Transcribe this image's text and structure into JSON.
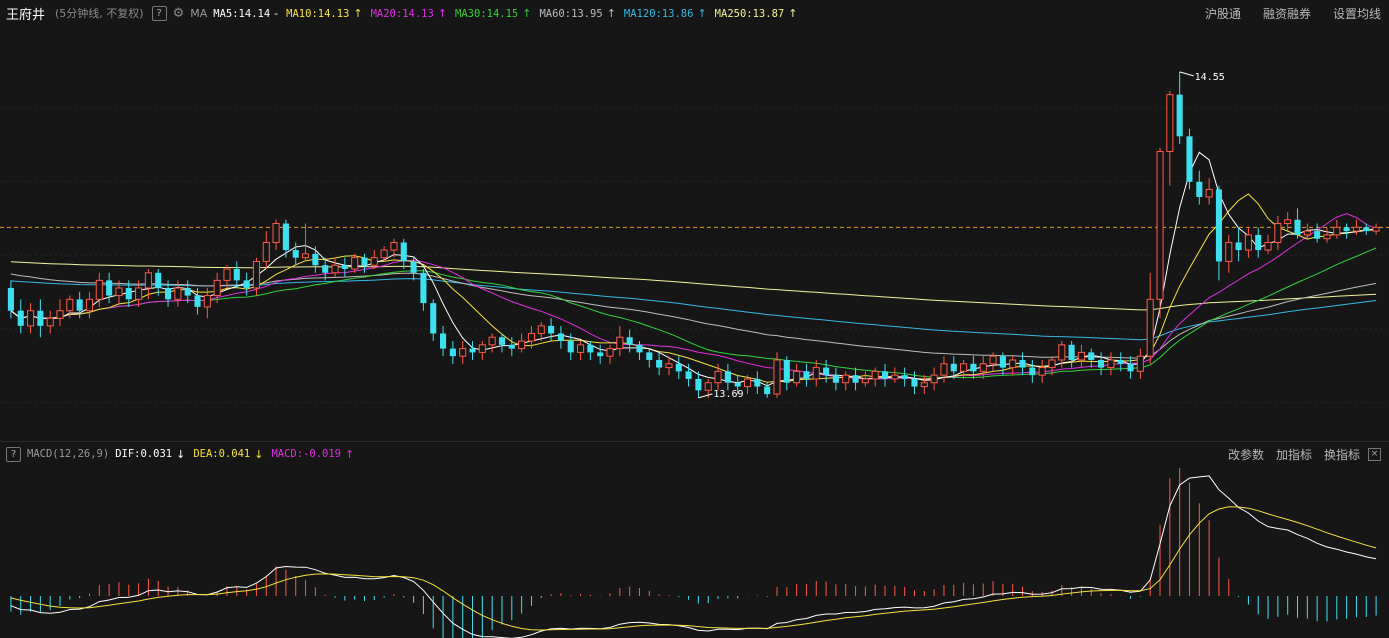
{
  "header": {
    "stock_name": "王府井",
    "period": "(5分钟线, 不复权)",
    "help": "?",
    "indicator": "MA",
    "ma": [
      {
        "label": "MA5:14.14",
        "arrow": "-",
        "color": "#ffffff"
      },
      {
        "label": "MA10:14.13",
        "arrow": "↑",
        "color": "#f7e23e"
      },
      {
        "label": "MA20:14.13",
        "arrow": "↑",
        "color": "#e030e0"
      },
      {
        "label": "MA30:14.15",
        "arrow": "↑",
        "color": "#34d23a"
      },
      {
        "label": "MA60:13.95",
        "arrow": "↑",
        "color": "#bdbdbd"
      },
      {
        "label": "MA120:13.86",
        "arrow": "↑",
        "color": "#35b8e8"
      },
      {
        "label": "MA250:13.87",
        "arrow": "↑",
        "color": "#f2f29a"
      }
    ],
    "links": [
      "沪股通",
      "融资融券",
      "设置均线"
    ]
  },
  "macd_header": {
    "help": "?",
    "title": "MACD(12,26,9)",
    "dif": "DIF:0.031",
    "dif_arrow": "↓",
    "dea": "DEA:0.041",
    "dea_arrow": "↓",
    "macd": "MACD:-0.019",
    "macd_arrow": "↑",
    "links": [
      "改参数",
      "加指标",
      "换指标"
    ],
    "close": "×"
  },
  "colors": {
    "up": "#ff5a46",
    "down": "#3ee0f0",
    "background": "#161616",
    "ma5": "#ffffff",
    "ma10": "#f7e23e",
    "ma20": "#e030e0",
    "ma30": "#34d23a",
    "ma60": "#bdbdbd",
    "ma120": "#35b8e8",
    "ma250": "#f2f29a",
    "dif": "#ffffff",
    "dea": "#f7e23e",
    "ref_line": "#e09a2a"
  },
  "chart_data": {
    "type": "candlestick",
    "ylim": [
      13.6,
      14.65
    ],
    "max_label": "14.55",
    "min_label": "13.69",
    "ref_price": 14.14,
    "candles": [
      [
        13.98,
        13.92,
        14.0,
        13.9
      ],
      [
        13.92,
        13.88,
        13.95,
        13.86
      ],
      [
        13.88,
        13.92,
        13.94,
        13.86
      ],
      [
        13.92,
        13.88,
        13.95,
        13.85
      ],
      [
        13.88,
        13.9,
        13.92,
        13.86
      ],
      [
        13.9,
        13.92,
        13.95,
        13.88
      ],
      [
        13.92,
        13.95,
        13.96,
        13.9
      ],
      [
        13.95,
        13.92,
        13.97,
        13.9
      ],
      [
        13.92,
        13.95,
        13.97,
        13.9
      ],
      [
        13.95,
        14.0,
        14.02,
        13.93
      ],
      [
        14.0,
        13.96,
        14.02,
        13.94
      ],
      [
        13.96,
        13.98,
        14.0,
        13.94
      ],
      [
        13.98,
        13.95,
        14.0,
        13.93
      ],
      [
        13.95,
        13.98,
        14.0,
        13.93
      ],
      [
        13.98,
        14.02,
        14.03,
        13.95
      ],
      [
        14.02,
        13.98,
        14.03,
        13.96
      ],
      [
        13.98,
        13.95,
        14.0,
        13.93
      ],
      [
        13.95,
        13.98,
        14.0,
        13.93
      ],
      [
        13.98,
        13.96,
        14.0,
        13.94
      ],
      [
        13.96,
        13.93,
        13.98,
        13.91
      ],
      [
        13.93,
        13.96,
        13.98,
        13.9
      ],
      [
        13.96,
        14.0,
        14.02,
        13.94
      ],
      [
        14.0,
        14.03,
        14.04,
        13.98
      ],
      [
        14.03,
        14.0,
        14.05,
        13.98
      ],
      [
        14.0,
        13.98,
        14.02,
        13.96
      ],
      [
        13.98,
        14.05,
        14.06,
        13.96
      ],
      [
        14.05,
        14.1,
        14.13,
        14.03
      ],
      [
        14.1,
        14.15,
        14.16,
        14.08
      ],
      [
        14.15,
        14.08,
        14.16,
        14.06
      ],
      [
        14.08,
        14.06,
        14.1,
        14.04
      ],
      [
        14.06,
        14.07,
        14.15,
        14.05
      ],
      [
        14.07,
        14.04,
        14.09,
        14.02
      ],
      [
        14.04,
        14.02,
        14.06,
        14.0
      ],
      [
        14.02,
        14.04,
        14.06,
        14.01
      ],
      [
        14.04,
        14.03,
        14.06,
        14.01
      ],
      [
        14.03,
        14.06,
        14.07,
        14.02
      ],
      [
        14.06,
        14.04,
        14.07,
        14.02
      ],
      [
        14.04,
        14.06,
        14.08,
        14.03
      ],
      [
        14.06,
        14.08,
        14.09,
        14.05
      ],
      [
        14.08,
        14.1,
        14.11,
        14.06
      ],
      [
        14.1,
        14.05,
        14.11,
        14.03
      ],
      [
        14.05,
        14.02,
        14.06,
        14.0
      ],
      [
        14.02,
        13.94,
        14.03,
        13.92
      ],
      [
        13.94,
        13.86,
        13.95,
        13.84
      ],
      [
        13.86,
        13.82,
        13.88,
        13.8
      ],
      [
        13.82,
        13.8,
        13.84,
        13.78
      ],
      [
        13.8,
        13.82,
        13.84,
        13.78
      ],
      [
        13.82,
        13.81,
        13.84,
        13.79
      ],
      [
        13.81,
        13.83,
        13.84,
        13.79
      ],
      [
        13.83,
        13.85,
        13.86,
        13.81
      ],
      [
        13.85,
        13.83,
        13.86,
        13.81
      ],
      [
        13.83,
        13.82,
        13.85,
        13.8
      ],
      [
        13.82,
        13.84,
        13.86,
        13.81
      ],
      [
        13.84,
        13.86,
        13.88,
        13.82
      ],
      [
        13.86,
        13.88,
        13.89,
        13.84
      ],
      [
        13.88,
        13.86,
        13.9,
        13.84
      ],
      [
        13.86,
        13.84,
        13.88,
        13.82
      ],
      [
        13.84,
        13.81,
        13.86,
        13.79
      ],
      [
        13.81,
        13.83,
        13.84,
        13.79
      ],
      [
        13.83,
        13.81,
        13.84,
        13.79
      ],
      [
        13.81,
        13.8,
        13.83,
        13.78
      ],
      [
        13.8,
        13.82,
        13.83,
        13.78
      ],
      [
        13.82,
        13.85,
        13.88,
        13.8
      ],
      [
        13.85,
        13.83,
        13.87,
        13.81
      ],
      [
        13.83,
        13.81,
        13.84,
        13.79
      ],
      [
        13.81,
        13.79,
        13.82,
        13.77
      ],
      [
        13.79,
        13.77,
        13.81,
        13.75
      ],
      [
        13.77,
        13.78,
        13.8,
        13.75
      ],
      [
        13.78,
        13.76,
        13.8,
        13.74
      ],
      [
        13.76,
        13.74,
        13.78,
        13.72
      ],
      [
        13.74,
        13.71,
        13.76,
        13.69
      ],
      [
        13.71,
        13.73,
        13.74,
        13.69
      ],
      [
        13.73,
        13.76,
        13.78,
        13.71
      ],
      [
        13.76,
        13.73,
        13.78,
        13.71
      ],
      [
        13.73,
        13.72,
        13.75,
        13.7
      ],
      [
        13.72,
        13.74,
        13.75,
        13.7
      ],
      [
        13.74,
        13.72,
        13.76,
        13.7
      ],
      [
        13.72,
        13.7,
        13.73,
        13.69
      ],
      [
        13.7,
        13.79,
        13.81,
        13.69
      ],
      [
        13.79,
        13.73,
        13.8,
        13.71
      ],
      [
        13.73,
        13.76,
        13.78,
        13.72
      ],
      [
        13.76,
        13.74,
        13.78,
        13.72
      ],
      [
        13.74,
        13.77,
        13.79,
        13.72
      ],
      [
        13.77,
        13.75,
        13.79,
        13.73
      ],
      [
        13.75,
        13.73,
        13.77,
        13.71
      ],
      [
        13.73,
        13.75,
        13.76,
        13.71
      ],
      [
        13.75,
        13.73,
        13.77,
        13.71
      ],
      [
        13.73,
        13.74,
        13.76,
        13.72
      ],
      [
        13.74,
        13.76,
        13.77,
        13.72
      ],
      [
        13.76,
        13.74,
        13.78,
        13.72
      ],
      [
        13.74,
        13.75,
        13.77,
        13.73
      ],
      [
        13.75,
        13.74,
        13.77,
        13.72
      ],
      [
        13.74,
        13.72,
        13.76,
        13.7
      ],
      [
        13.72,
        13.73,
        13.75,
        13.7
      ],
      [
        13.73,
        13.75,
        13.77,
        13.71
      ],
      [
        13.75,
        13.78,
        13.8,
        13.73
      ],
      [
        13.78,
        13.76,
        13.8,
        13.74
      ],
      [
        13.76,
        13.78,
        13.79,
        13.74
      ],
      [
        13.78,
        13.76,
        13.8,
        13.74
      ],
      [
        13.76,
        13.78,
        13.8,
        13.74
      ],
      [
        13.78,
        13.8,
        13.81,
        13.76
      ],
      [
        13.8,
        13.77,
        13.81,
        13.75
      ],
      [
        13.77,
        13.79,
        13.8,
        13.75
      ],
      [
        13.79,
        13.77,
        13.81,
        13.75
      ],
      [
        13.77,
        13.75,
        13.79,
        13.73
      ],
      [
        13.75,
        13.77,
        13.79,
        13.73
      ],
      [
        13.77,
        13.79,
        13.8,
        13.75
      ],
      [
        13.79,
        13.83,
        13.84,
        13.77
      ],
      [
        13.83,
        13.79,
        13.84,
        13.77
      ],
      [
        13.79,
        13.81,
        13.83,
        13.77
      ],
      [
        13.81,
        13.79,
        13.82,
        13.77
      ],
      [
        13.79,
        13.77,
        13.81,
        13.75
      ],
      [
        13.77,
        13.79,
        13.81,
        13.75
      ],
      [
        13.79,
        13.78,
        13.81,
        13.76
      ],
      [
        13.78,
        13.76,
        13.8,
        13.74
      ],
      [
        13.76,
        13.8,
        13.82,
        13.74
      ],
      [
        13.8,
        13.95,
        14.02,
        13.78
      ],
      [
        13.95,
        14.34,
        14.35,
        13.9
      ],
      [
        14.34,
        14.49,
        14.5,
        14.25
      ],
      [
        14.49,
        14.38,
        14.55,
        14.36
      ],
      [
        14.38,
        14.26,
        14.4,
        14.24
      ],
      [
        14.26,
        14.22,
        14.29,
        14.2
      ],
      [
        14.22,
        14.24,
        14.27,
        14.2
      ],
      [
        14.24,
        14.05,
        14.25,
        14.0
      ],
      [
        14.05,
        14.1,
        14.12,
        14.02
      ],
      [
        14.1,
        14.08,
        14.14,
        14.05
      ],
      [
        14.08,
        14.12,
        14.14,
        14.06
      ],
      [
        14.12,
        14.08,
        14.14,
        14.06
      ],
      [
        14.08,
        14.1,
        14.12,
        14.07
      ],
      [
        14.1,
        14.15,
        14.17,
        14.08
      ],
      [
        14.15,
        14.16,
        14.18,
        14.13
      ],
      [
        14.16,
        14.12,
        14.19,
        14.11
      ],
      [
        14.12,
        14.13,
        14.15,
        14.11
      ],
      [
        14.13,
        14.11,
        14.15,
        14.1
      ],
      [
        14.11,
        14.12,
        14.14,
        14.1
      ],
      [
        14.12,
        14.14,
        14.16,
        14.11
      ],
      [
        14.14,
        14.13,
        14.15,
        14.11
      ],
      [
        14.13,
        14.14,
        14.16,
        14.12
      ],
      [
        14.14,
        14.13,
        14.15,
        14.12
      ],
      [
        14.13,
        14.14,
        14.15,
        14.12
      ]
    ]
  }
}
